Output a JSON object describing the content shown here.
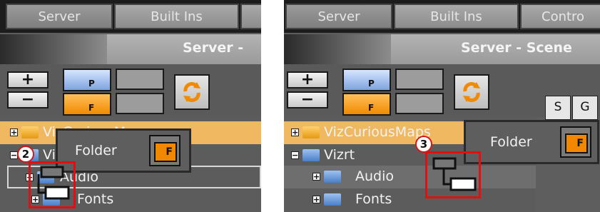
{
  "left": {
    "tabs": [
      "Server",
      "Built Ins"
    ],
    "title": "Server - ",
    "toolbar": {
      "plus": "+",
      "minus": "−",
      "p_label": "P",
      "f_label": "F"
    },
    "tree": [
      {
        "label": "VizCuriousMaps",
        "expander": "+",
        "color": "yellow"
      },
      {
        "label": "Vi",
        "expander": "−",
        "color": "blue"
      },
      {
        "label": "Audio",
        "expander": "+",
        "color": "blue"
      },
      {
        "label": "Fonts",
        "expander": "+",
        "color": "blue"
      }
    ],
    "popup": {
      "label": "Folder",
      "icon_label": "F"
    },
    "step_badge": "2"
  },
  "right": {
    "tabs": [
      "Server",
      "Built Ins",
      "Contro"
    ],
    "title": "Server - Scene",
    "toolbar": {
      "plus": "+",
      "minus": "−",
      "p_label": "P",
      "f_label": "F"
    },
    "side_tabs": [
      "S",
      "G"
    ],
    "tree": [
      {
        "label": "VizCuriousMaps",
        "expander": "+",
        "color": "yellow"
      },
      {
        "label": "Vizrt",
        "expander": "−",
        "color": "blue"
      },
      {
        "label": "Audio",
        "expander": "+",
        "color": "blue"
      },
      {
        "label": "Fonts",
        "expander": "+",
        "color": "blue"
      }
    ],
    "popup": {
      "label": "Folder",
      "icon_label": "F"
    },
    "step_badge": "3"
  },
  "colors": {
    "accent_orange": "#f28800",
    "highlight_row": "#f0b860",
    "callout_red": "#e01010"
  },
  "icons": [
    "plus-icon",
    "minus-icon",
    "folder-icon",
    "refresh-icon",
    "drag-folder-icon"
  ]
}
